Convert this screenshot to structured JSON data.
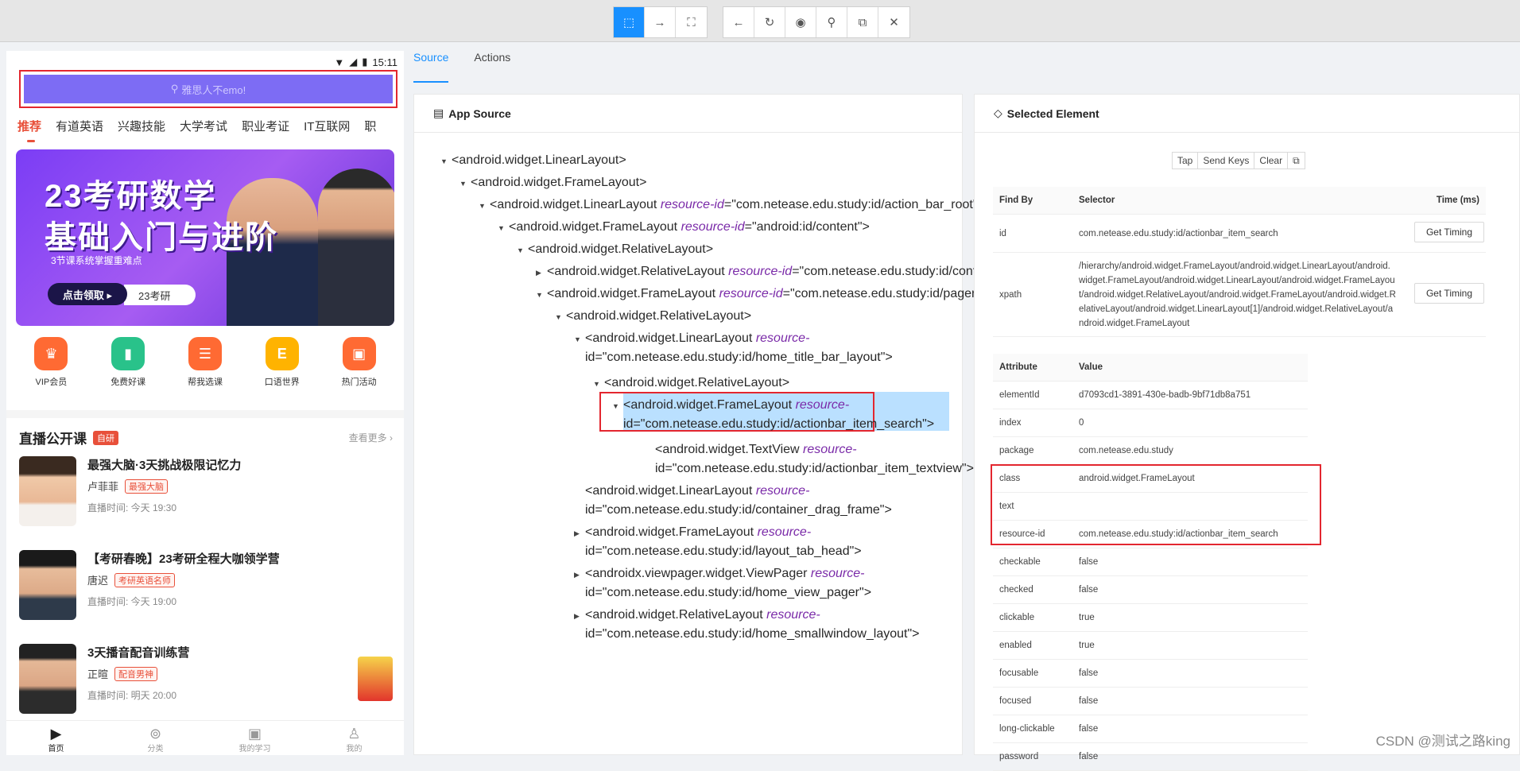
{
  "toolbar": {
    "buttons": [
      "select-icon",
      "swipe-icon",
      "screenshot-region-icon",
      "back-icon",
      "refresh-icon",
      "eye-icon",
      "search-icon",
      "copy-icon",
      "close-icon"
    ]
  },
  "phone": {
    "status_time": "15:11",
    "search_placeholder": "雅思人不emo!",
    "categories": [
      "推荐",
      "有道英语",
      "兴趣技能",
      "大学考试",
      "职业考证",
      "IT互联网",
      "职"
    ],
    "banner": {
      "line1": "23考研数学",
      "line2": "基础入门与进阶",
      "line3": "3节课系统掌握重难点",
      "cta": "点击领取 ▸",
      "tag": "23考研"
    },
    "quick_icons": [
      {
        "label": "VIP会员",
        "color": "#ff6a33"
      },
      {
        "label": "免费好课",
        "color": "#29c28a"
      },
      {
        "label": "帮我选课",
        "color": "#ff6a33"
      },
      {
        "label": "口语世界",
        "color": "#ffb300"
      },
      {
        "label": "热门活动",
        "color": "#ff6a33"
      }
    ],
    "live_title": "直播公开课",
    "live_badge": "自研",
    "more": "查看更多 ›",
    "courses": [
      {
        "title": "最强大脑·3天挑战极限记忆力",
        "teacher": "卢菲菲",
        "tag": "最强大脑",
        "time": "直播时间: 今天 19:30"
      },
      {
        "title": "【考研春晚】23考研全程大咖领学营",
        "teacher": "唐迟",
        "tag": "考研英语名师",
        "time": "直播时间: 今天 19:00"
      },
      {
        "title": "3天播音配音训练营",
        "teacher": "正暄",
        "tag": "配音男神",
        "time": "直播时间: 明天 20:00"
      }
    ],
    "nav": [
      "首页",
      "分类",
      "我的学习",
      "我的"
    ]
  },
  "tabs": [
    "Source",
    "Actions"
  ],
  "source_panel": {
    "title": "App Source",
    "nodes": [
      {
        "tri": "▼",
        "tag": "<android.widget.LinearLayout>",
        "attr": "",
        "val": "",
        "cont": ""
      },
      {
        "tri": "▼",
        "tag": "<android.widget.FrameLayout>",
        "attr": "",
        "val": "",
        "cont": ""
      },
      {
        "tri": "▼",
        "tag": "<android.widget.LinearLayout ",
        "attr": "resource-id",
        "val": "=\"com.netease.edu.study:id/action_bar_root\">",
        "cont": ""
      },
      {
        "tri": "▼",
        "tag": "<android.widget.FrameLayout ",
        "attr": "resource-id",
        "val": "=\"android:id/content\">",
        "cont": ""
      },
      {
        "tri": "▼",
        "tag": "<android.widget.RelativeLayout>",
        "attr": "",
        "val": "",
        "cont": ""
      },
      {
        "tri": "▶",
        "tag": "<android.widget.RelativeLayout ",
        "attr": "resource-id",
        "val": "=\"com.netease.edu.study:id/container\">",
        "cont": ""
      },
      {
        "tri": "▼",
        "tag": "<android.widget.FrameLayout ",
        "attr": "resource-id",
        "val": "=\"com.netease.edu.study:id/pager\">",
        "cont": ""
      },
      {
        "tri": "▼",
        "tag": "<android.widget.RelativeLayout>",
        "attr": "",
        "val": "",
        "cont": ""
      },
      {
        "tri": "▼",
        "tag": "<android.widget.LinearLayout ",
        "attr": "resource-",
        "val": "",
        "cont": "id=\"com.netease.edu.study:id/home_title_bar_layout\">"
      },
      {
        "tri": "▼",
        "tag": "<android.widget.RelativeLayout>",
        "attr": "",
        "val": "",
        "cont": ""
      },
      {
        "tri": "▼",
        "tag": "<android.widget.FrameLayout ",
        "attr": "resource-",
        "val": "",
        "cont": "id=\"com.netease.edu.study:id/actionbar_item_search\">"
      },
      {
        "tri": "",
        "tag": "<android.widget.TextView ",
        "attr": "resource-",
        "val": "",
        "cont": "id=\"com.netease.edu.study:id/actionbar_item_textview\">"
      },
      {
        "tri": "",
        "tag": "<android.widget.LinearLayout ",
        "attr": "resource-",
        "val": "",
        "cont": "id=\"com.netease.edu.study:id/container_drag_frame\">"
      },
      {
        "tri": "▶",
        "tag": "<android.widget.FrameLayout ",
        "attr": "resource-",
        "val": "",
        "cont": "id=\"com.netease.edu.study:id/layout_tab_head\">"
      },
      {
        "tri": "▶",
        "tag": "<androidx.viewpager.widget.ViewPager ",
        "attr": "resource-",
        "val": "",
        "cont": "id=\"com.netease.edu.study:id/home_view_pager\">"
      },
      {
        "tri": "▶",
        "tag": "<android.widget.RelativeLayout ",
        "attr": "resource-",
        "val": "",
        "cont": "id=\"com.netease.edu.study:id/home_smallwindow_layout\">"
      }
    ]
  },
  "selected_panel": {
    "title": "Selected Element",
    "actions": [
      "Tap",
      "Send Keys",
      "Clear",
      "⧉"
    ],
    "find_by_header": {
      "find_by": "Find By",
      "selector": "Selector",
      "time": "Time (ms)"
    },
    "find_by_rows": [
      {
        "by": "id",
        "selector": "com.netease.edu.study:id/actionbar_item_search",
        "btn": "Get Timing"
      },
      {
        "by": "xpath",
        "selector": "/hierarchy/android.widget.FrameLayout/android.widget.LinearLayout/android.widget.FrameLayout/android.widget.LinearLayout/android.widget.FrameLayout/android.widget.RelativeLayout/android.widget.FrameLayout/android.widget.RelativeLayout/android.widget.LinearLayout[1]/android.widget.RelativeLayout/android.widget.FrameLayout",
        "btn": "Get Timing"
      }
    ],
    "attr_header": {
      "attribute": "Attribute",
      "value": "Value"
    },
    "attributes": [
      {
        "k": "elementId",
        "v": "d7093cd1-3891-430e-badb-9bf71db8a751"
      },
      {
        "k": "index",
        "v": "0"
      },
      {
        "k": "package",
        "v": "com.netease.edu.study"
      },
      {
        "k": "class",
        "v": "android.widget.FrameLayout"
      },
      {
        "k": "text",
        "v": ""
      },
      {
        "k": "resource-id",
        "v": "com.netease.edu.study:id/actionbar_item_search"
      },
      {
        "k": "checkable",
        "v": "false"
      },
      {
        "k": "checked",
        "v": "false"
      },
      {
        "k": "clickable",
        "v": "true"
      },
      {
        "k": "enabled",
        "v": "true"
      },
      {
        "k": "focusable",
        "v": "false"
      },
      {
        "k": "focused",
        "v": "false"
      },
      {
        "k": "long-clickable",
        "v": "false"
      },
      {
        "k": "password",
        "v": "false"
      }
    ]
  },
  "watermark": "CSDN @测试之路king"
}
